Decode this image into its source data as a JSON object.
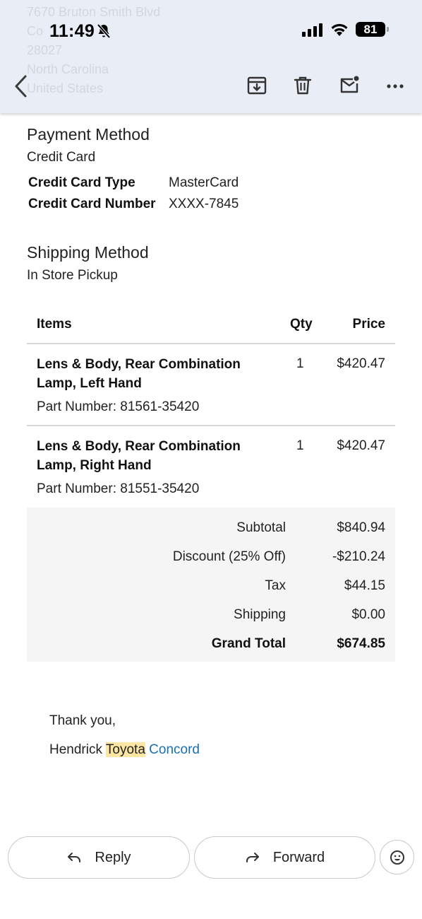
{
  "status_bar": {
    "time": "11:49",
    "battery": "81"
  },
  "background_address": [
    "7670 Bruton Smith Blvd",
    "Co",
    "28027",
    "North Carolina",
    "United States"
  ],
  "toolbar": {
    "back": "back-icon",
    "archive": "archive-icon",
    "delete": "trash-icon",
    "mark_unread": "mail-unread-icon",
    "more": "more-icon"
  },
  "payment": {
    "title": "Payment Method",
    "method": "Credit Card",
    "card_type_label": "Credit Card Type",
    "card_type_value": "MasterCard",
    "card_number_label": "Credit Card Number",
    "card_number_value": "XXXX-7845"
  },
  "shipping": {
    "title": "Shipping Method",
    "method": "In Store Pickup"
  },
  "items_table": {
    "headers": {
      "items": "Items",
      "qty": "Qty",
      "price": "Price"
    },
    "rows": [
      {
        "name": "Lens & Body, Rear Combination Lamp, Left Hand",
        "part_number": "Part Number: 81561-35420",
        "qty": "1",
        "price": "$420.47"
      },
      {
        "name": "Lens & Body, Rear Combination Lamp, Right Hand",
        "part_number": "Part Number: 81551-35420",
        "qty": "1",
        "price": "$420.47"
      }
    ]
  },
  "totals": {
    "subtotal_label": "Subtotal",
    "subtotal_value": "$840.94",
    "discount_label": "Discount (25% Off)",
    "discount_value": "-$210.24",
    "tax_label": "Tax",
    "tax_value": "$44.15",
    "shipping_label": "Shipping",
    "shipping_value": "$0.00",
    "grand_total_label": "Grand Total",
    "grand_total_value": "$674.85"
  },
  "signature": {
    "thanks": "Thank you,",
    "name_part1": "Hendrick ",
    "name_highlight": "Toyota",
    "name_link": "Concord"
  },
  "actions": {
    "reply": "Reply",
    "forward": "Forward"
  },
  "colors": {
    "topbar_bg": "#e9eef6",
    "link": "#1a6fb0",
    "highlight": "#fde5a3",
    "totals_bg": "#f5f5f5"
  }
}
